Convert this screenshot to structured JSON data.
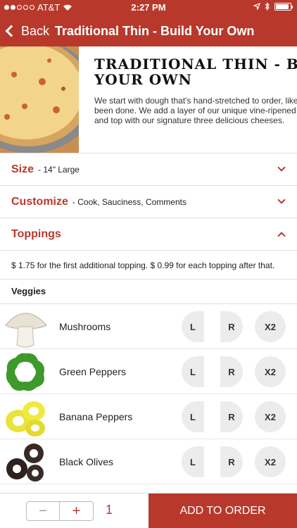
{
  "status": {
    "carrier": "AT&T",
    "time": "2:27 PM"
  },
  "nav": {
    "back_label": "Back",
    "title": "Traditional Thin - Build Your Own"
  },
  "hero": {
    "title_line1": "Traditional Thin - Build",
    "title_line2": "Your Own",
    "desc_line1": "We start with dough that's hand-stretched to order, like it's al",
    "desc_line2": "been done. We add a layer of our unique vine-ripened tomato",
    "desc_line3": "and top with our signature three delicious cheeses."
  },
  "sections": {
    "size": {
      "title": "Size",
      "value": "- 14\" Large"
    },
    "customize": {
      "title": "Customize",
      "value": "- Cook, Sauciness, Comments"
    },
    "toppings": {
      "title": "Toppings"
    }
  },
  "pricing_note": "$ 1.75 for the first additional topping. $ 0.99 for each topping after that.",
  "veggies_label": "Veggies",
  "toppings": [
    {
      "name": "Mushrooms",
      "icon": "mushroom-icon"
    },
    {
      "name": "Green Peppers",
      "icon": "green-pepper-icon"
    },
    {
      "name": "Banana Peppers",
      "icon": "banana-pepper-icon"
    },
    {
      "name": "Black Olives",
      "icon": "black-olive-icon"
    }
  ],
  "topping_options": {
    "left": "L",
    "right": "R",
    "double": "X2"
  },
  "bottom": {
    "minus": "−",
    "plus": "+",
    "quantity": "1",
    "add_label": "ADD TO ORDER"
  },
  "colors": {
    "brand": "#b8392c"
  }
}
